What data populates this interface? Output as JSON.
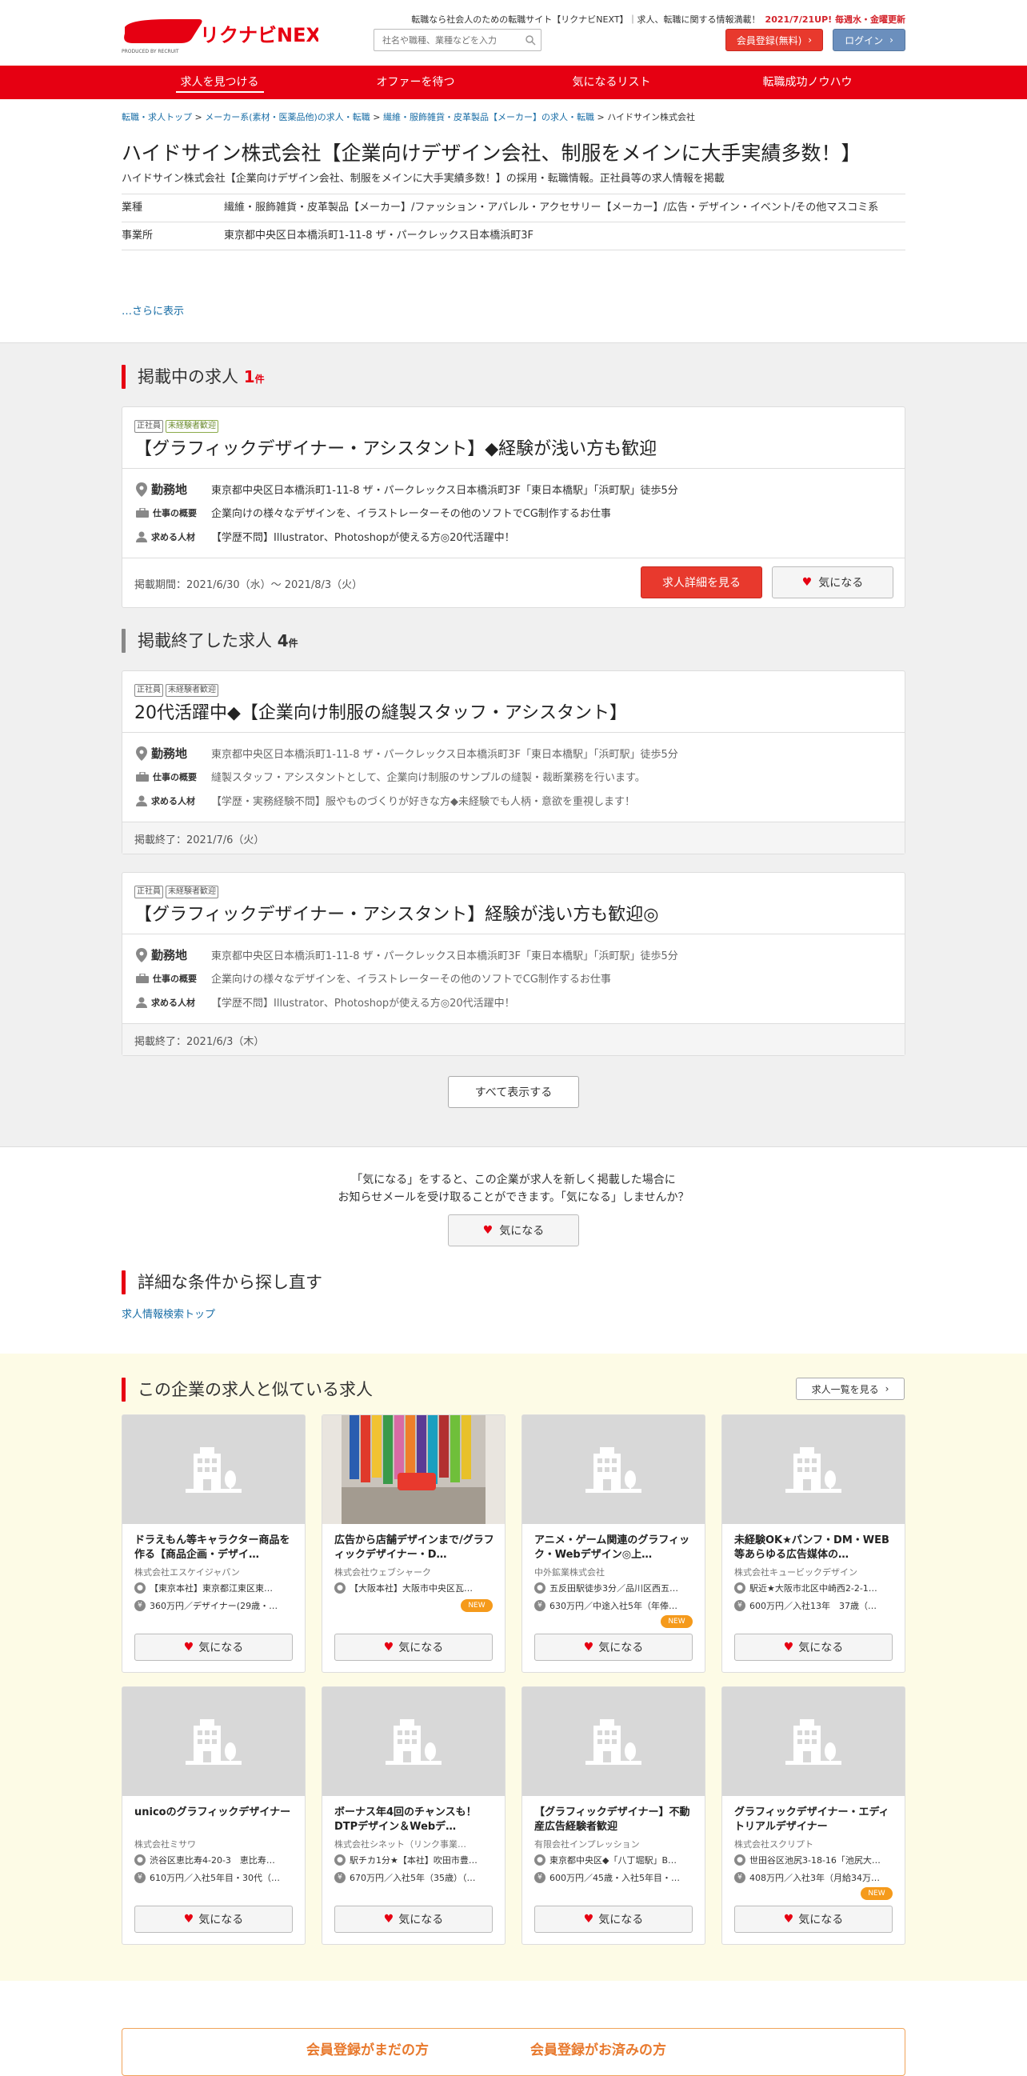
{
  "header": {
    "tagline": "転職なら社会人のための転職サイト【リクナビNEXT】｜求人、転職に関する情報満載！",
    "update": "2021/7/21UP! 毎週水・金曜更新",
    "search_placeholder": "社名や職種、業種などを入力",
    "register_label": "会員登録(無料)",
    "login_label": "ログイン",
    "logo_text": "リクナビNEXT",
    "logo_sub": "PRODUCED BY RECRUIT"
  },
  "nav": [
    "求人を見つける",
    "オファーを待つ",
    "気になるリスト",
    "転職成功ノウハウ"
  ],
  "breadcrumb": {
    "items": [
      "転職・求人トップ",
      "メーカー系(素材・医薬品他)の求人・転職",
      "繊維・服飾雑貨・皮革製品【メーカー】の求人・転職"
    ],
    "current": "ハイドサイン株式会社"
  },
  "company": {
    "title": "ハイドサイン株式会社【企業向けデザイン会社、制服をメインに大手実績多数！】",
    "subtitle": "ハイドサイン株式会社【企業向けデザイン会社、制服をメインに大手実績多数！】の採用・転職情報。正社員等の求人情報を掲載",
    "industry_label": "業種",
    "industry": "繊維・服飾雑貨・皮革製品【メーカー】/ファッション・アパレル・アクセサリー【メーカー】/広告・デザイン・イベント/その他マスコミ系",
    "office_label": "事業所",
    "office": "東京都中央区日本橋浜町1-11-8 ザ・パークレックス日本橋浜町3F",
    "more": "…さらに表示"
  },
  "active": {
    "heading": "掲載中の求人",
    "count": "1",
    "count_unit": "件",
    "job": {
      "tags": [
        "正社員",
        "未経験者歓迎"
      ],
      "title": "【グラフィックデザイナー・アシスタント】◆経験が浅い方も歓迎",
      "loc_label": "勤務地",
      "loc": "東京都中央区日本橋浜町1-11-8 ザ・パークレックス日本橋浜町3F「東日本橋駅」「浜町駅」徒歩5分",
      "work_label": "仕事の概要",
      "work": "企業向けの様々なデザインを、イラストレーターその他のソフトでCG制作するお仕事",
      "req_label": "求める人材",
      "req": "【学歴不問】Illustrator、Photoshopが使える方◎20代活躍中！",
      "period": "掲載期間：2021/6/30（水）～ 2021/8/3（火）",
      "detail_button": "求人詳細を見る",
      "fav_button": "気になる"
    }
  },
  "ended": {
    "heading": "掲載終了した求人",
    "count": "4",
    "count_unit": "件",
    "jobs": [
      {
        "tags": [
          "正社員",
          "未経験者歓迎"
        ],
        "title": "20代活躍中◆【企業向け制服の縫製スタッフ・アシスタント】",
        "loc_label": "勤務地",
        "loc": "東京都中央区日本橋浜町1-11-8 ザ・パークレックス日本橋浜町3F「東日本橋駅」「浜町駅」徒歩5分",
        "work_label": "仕事の概要",
        "work": "縫製スタッフ・アシスタントとして、企業向け制服のサンプルの縫製・裁断業務を行います。",
        "req_label": "求める人材",
        "req": "【学歴・実務経験不問】服やものづくりが好きな方◆未経験でも人柄・意欲を重視します！",
        "period": "掲載終了：2021/7/6（火）"
      },
      {
        "tags": [
          "正社員",
          "未経験者歓迎"
        ],
        "title": "【グラフィックデザイナー・アシスタント】経験が浅い方も歓迎◎",
        "loc_label": "勤務地",
        "loc": "東京都中央区日本橋浜町1-11-8 ザ・パークレックス日本橋浜町3F「東日本橋駅」「浜町駅」徒歩5分",
        "work_label": "仕事の概要",
        "work": "企業向けの様々なデザインを、イラストレーターその他のソフトでCG制作するお仕事",
        "req_label": "求める人材",
        "req": "【学歴不問】Illustrator、Photoshopが使える方◎20代活躍中！",
        "period": "掲載終了：2021/6/3（木）"
      }
    ],
    "show_all": "すべて表示する"
  },
  "notice": {
    "line1": "「気になる」をすると、この企業が求人を新しく掲載した場合に",
    "line2": "お知らせメールを受け取ることができます。「気になる」しませんか？",
    "fav_button": "気になる"
  },
  "research": {
    "heading": "詳細な条件から探し直す",
    "link": "求人情報検索トップ"
  },
  "similar": {
    "heading": "この企業の求人と似ている求人",
    "list_button": "求人一覧を見る",
    "fav_label": "気になる",
    "items": [
      {
        "title": "ドラえもん等キャラクター商品を作る【商品企画・デザイ…",
        "company": "株式会社エスケイジャパン",
        "loc": "【東京本社】東京都江東区東…",
        "sal": "360万円／デザイナー(29歳・…",
        "new": ""
      },
      {
        "title": "広告から店舗デザインまで/グラフィックデザイナー・D…",
        "company": "株式会社ウェブシャーク",
        "loc": "【大阪本社】大阪市中央区瓦…",
        "sal": "",
        "new": "NEW"
      },
      {
        "title": "アニメ・ゲーム関連のグラフィック・Webデザイン◎上…",
        "company": "中外鉱業株式会社",
        "loc": "五反田駅徒歩3分／品川区西五…",
        "sal": "630万円／中途入社5年（年俸…",
        "new": "NEW"
      },
      {
        "title": "未経験OK★パンフ・DM・WEB等あらゆる広告媒体の…",
        "company": "株式会社キュービックデザイン",
        "loc": "駅近★大阪市北区中崎西2-2-1…",
        "sal": "600万円／入社13年　37歳（…",
        "new": ""
      },
      {
        "title": "unicoのグラフィックデザイナー",
        "company": "株式会社ミサワ",
        "loc": "渋谷区恵比寿4-20-3　恵比寿…",
        "sal": "610万円／入社5年目・30代（…",
        "new": ""
      },
      {
        "title": "ボーナス年4回のチャンスも！DTPデザイン＆Webデ…",
        "company": "株式会社シネット（リンク事業…",
        "loc": "駅チカ1分★【本社】吹田市豊…",
        "sal": "670万円／入社5年（35歳）（…",
        "new": ""
      },
      {
        "title": "【グラフィックデザイナー】不動産広告経験者歓迎",
        "company": "有限会社インプレッション",
        "loc": "東京都中央区◆「八丁堀駅」B…",
        "sal": "600万円／45歳・入社5年目・…",
        "new": ""
      },
      {
        "title": "グラフィックデザイナー・エディトリアルデザイナー",
        "company": "株式会社スクリプト",
        "loc": "世田谷区池尻3-18-16「池尻大…",
        "sal": "408万円／入社3年（月給34万…",
        "new": "NEW"
      }
    ]
  },
  "bottom": {
    "left": "会員登録がまだの方",
    "right": "会員登録がお済みの方"
  }
}
